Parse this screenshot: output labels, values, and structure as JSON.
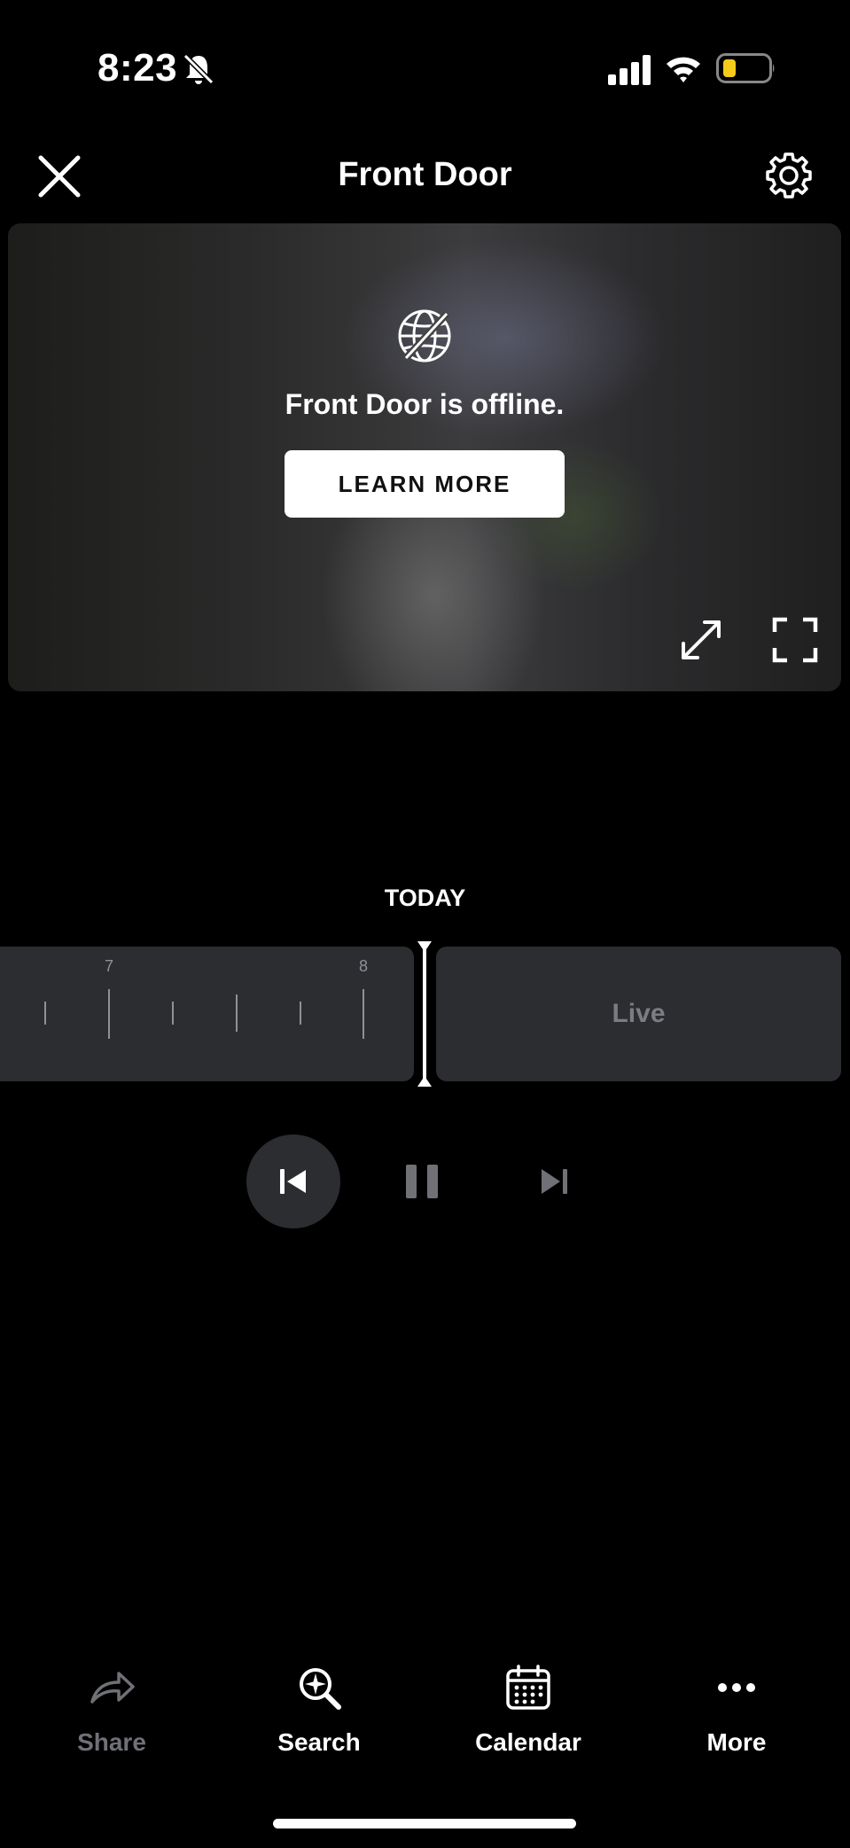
{
  "status_bar": {
    "time": "8:23"
  },
  "header": {
    "title": "Front Door"
  },
  "video": {
    "offline_message": "Front Door is offline.",
    "learn_more_label": "LEARN MORE"
  },
  "timeline": {
    "day_label": "TODAY",
    "hour_labels": [
      "7",
      "8"
    ],
    "live_label": "Live"
  },
  "bottom_bar": {
    "share_label": "Share",
    "search_label": "Search",
    "calendar_label": "Calendar",
    "more_label": "More"
  },
  "colors": {
    "background": "#000000",
    "panel": "#2b2d31",
    "muted_text": "#7b7d82",
    "battery_fill": "#f5cc1a"
  },
  "icons": {
    "status": [
      "bell-slash-icon",
      "signal-icon",
      "wifi-icon",
      "battery-icon"
    ],
    "header": [
      "close-icon",
      "gear-icon"
    ],
    "video": [
      "globe-offline-icon",
      "expand-icon",
      "fullscreen-icon"
    ],
    "playback": [
      "skip-previous-icon",
      "pause-icon",
      "skip-next-icon"
    ],
    "tabs": [
      "share-icon",
      "search-sparkle-icon",
      "calendar-icon",
      "more-icon"
    ]
  }
}
